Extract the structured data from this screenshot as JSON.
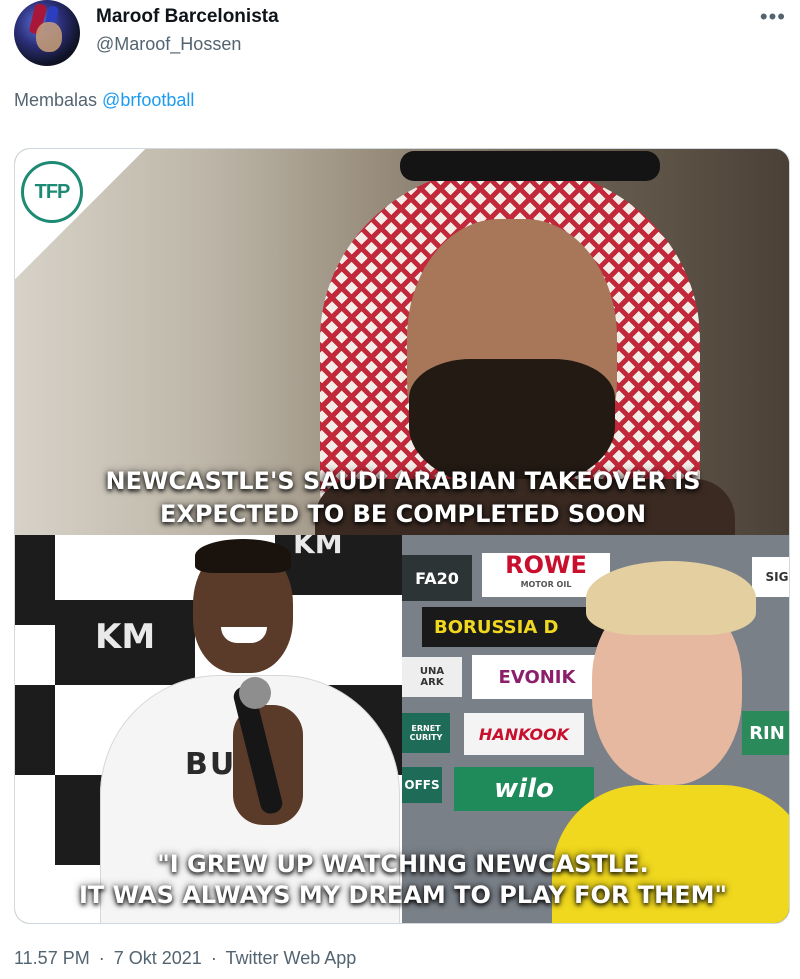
{
  "tweet": {
    "author_name": "Maroof Barcelonista",
    "author_handle": "@Maroof_Hossen",
    "more_icon": "•••",
    "reply_prefix": "Membalas",
    "reply_mention": "@brfootball"
  },
  "media": {
    "logo_text": "TFP",
    "top_caption": [
      "NEWCASTLE'S SAUDI ARABIAN TAKEOVER IS",
      "EXPECTED TO BE COMPLETED SOON"
    ],
    "bottom_caption": [
      "\"I GREW UP WATCHING NEWCASTLE.",
      "IT WAS ALWAYS MY DREAM TO PLAY FOR THEM\""
    ],
    "left_panel": {
      "board_text_1": "KM",
      "board_text_2": "KM",
      "shirt_text": "BUK"
    },
    "right_panel": {
      "ads": [
        "FA20",
        "ROWE",
        "MOTOR OIL",
        "SIGN",
        "BORUSSIA D",
        "UNA",
        "ARK",
        "EVONIK",
        "ERNET",
        "CURITY",
        "HANKOOK",
        "RIN",
        "OFFS",
        "wilo"
      ]
    }
  },
  "footer": {
    "time": "11.57 PM",
    "date": "7 Okt 2021",
    "source": "Twitter Web App",
    "separator": "·"
  },
  "colors": {
    "text_primary": "#0f1419",
    "text_secondary": "#536471",
    "link": "#1d9bf0",
    "border": "#cfd9de",
    "tfp_green": "#1d8a73"
  }
}
